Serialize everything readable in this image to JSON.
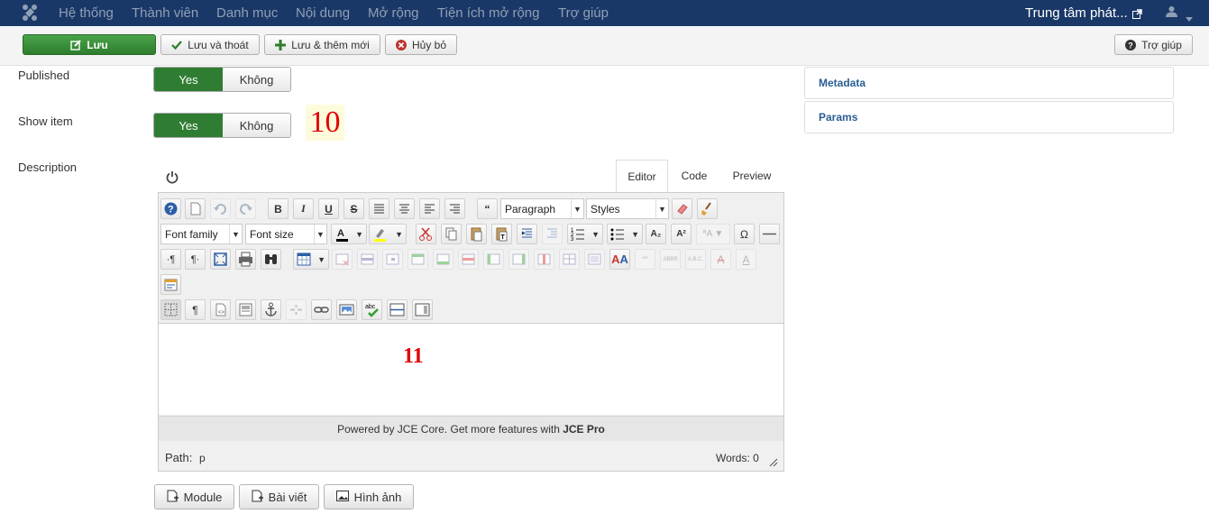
{
  "nav": {
    "items": [
      "Hệ thống",
      "Thành viên",
      "Danh mục",
      "Nội dung",
      "Mở rộng",
      "Tiện ích mở rộng",
      "Trợ giúp"
    ],
    "site_title": "Trung tâm phát...",
    "icons": [
      "joomla-logo-icon",
      "external-link-icon",
      "user-icon",
      "caret-down-icon"
    ]
  },
  "toolbar": {
    "save": "Lưu",
    "save_close": "Lưu và thoát",
    "save_new": "Lưu & thêm mới",
    "cancel": "Hủy bỏ",
    "help": "Trợ giúp"
  },
  "form": {
    "published_label": "Published",
    "show_item_label": "Show item",
    "description_label": "Description",
    "yes": "Yes",
    "no": "Không"
  },
  "annotations": {
    "a10": "10",
    "a11": "11"
  },
  "editor": {
    "tabs": [
      "Editor",
      "Code",
      "Preview"
    ],
    "active_tab": "Editor",
    "format_select": "Paragraph",
    "styles_select": "Styles",
    "font_family": "Font family",
    "font_size": "Font size",
    "powered_text": "Powered by JCE Core. Get more features with ",
    "powered_bold": "JCE Pro",
    "path_label": "Path:",
    "path_value": "p",
    "words": "Words: 0"
  },
  "sidebar": {
    "panels": [
      "Metadata",
      "Params"
    ]
  },
  "editor_buttons": [
    "Module",
    "Bài viết",
    "Hình ảnh"
  ],
  "colors": {
    "nav_bg": "#1a3867",
    "green": "#2f7d32",
    "link": "#2a5e94",
    "anno": "#e00000"
  }
}
